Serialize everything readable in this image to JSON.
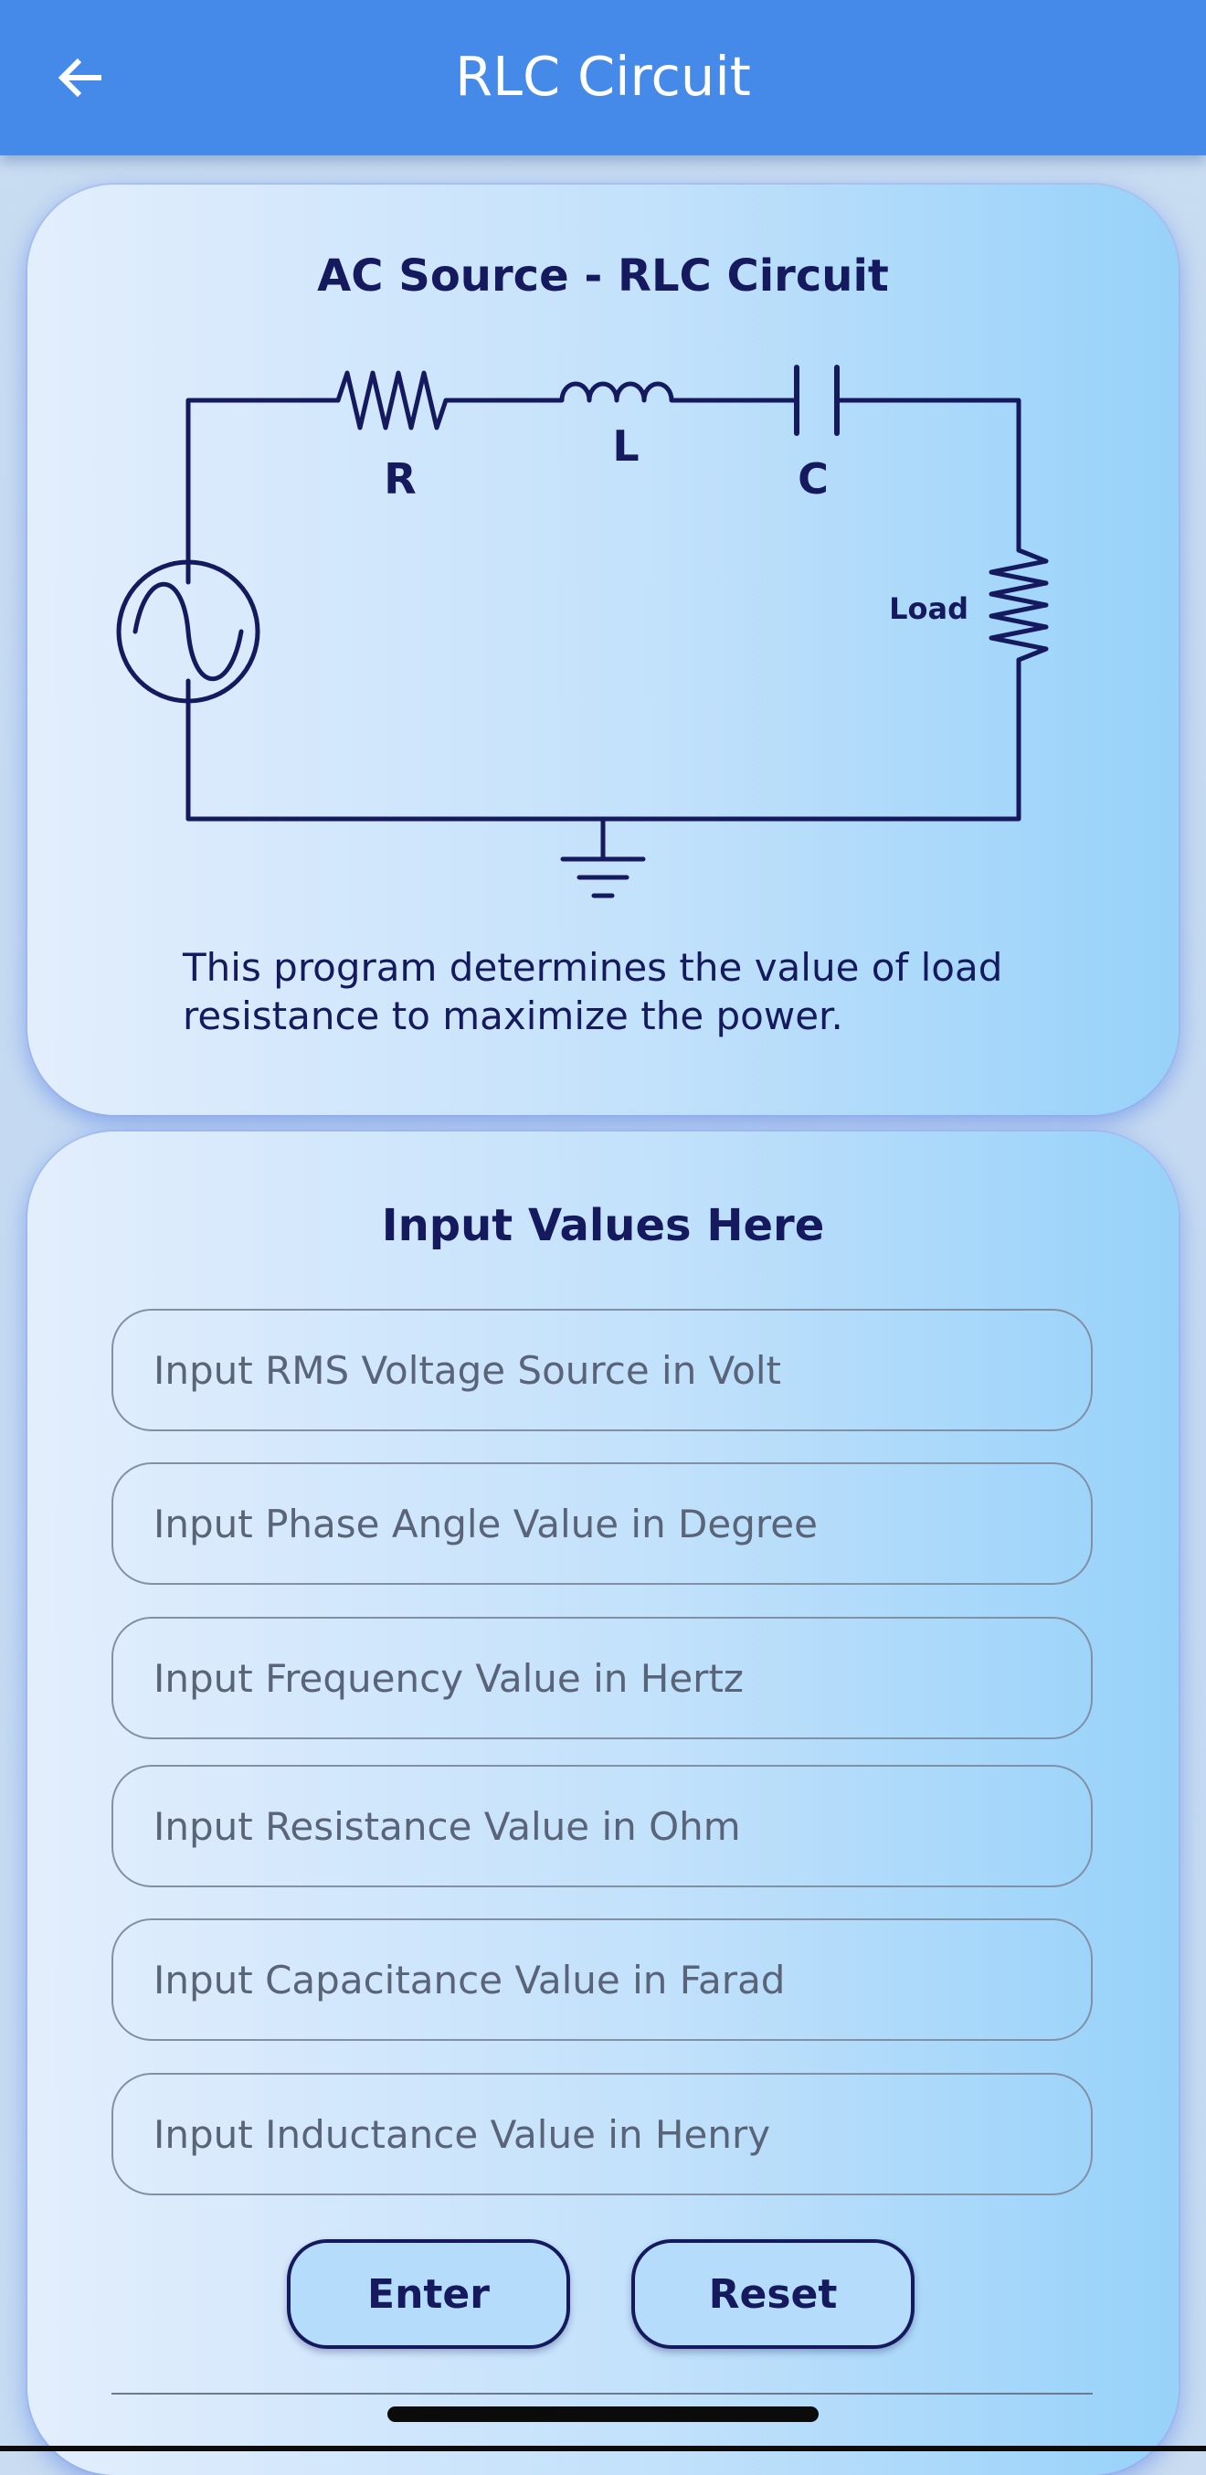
{
  "app_bar": {
    "title": "RLC Circuit",
    "back_icon": "arrow-left-icon",
    "color": "#458ae8"
  },
  "circuit_card": {
    "title": "AC Source - RLC Circuit",
    "labels": {
      "resistor": "R",
      "inductor": "L",
      "capacitor": "C",
      "load": "Load"
    },
    "description": "This program determines the value of load resistance to maximize the power."
  },
  "input_card": {
    "title": "Input Values Here",
    "fields": [
      {
        "placeholder": "Input RMS Voltage Source in Volt",
        "value": ""
      },
      {
        "placeholder": "Input Phase Angle Value in Degree",
        "value": ""
      },
      {
        "placeholder": "Input Frequency Value in Hertz",
        "value": ""
      },
      {
        "placeholder": "Input Resistance Value in Ohm",
        "value": ""
      },
      {
        "placeholder": "Input Capacitance Value in Farad",
        "value": ""
      },
      {
        "placeholder": "Input Inductance Value in Henry",
        "value": ""
      }
    ],
    "enter_label": "Enter",
    "reset_label": "Reset"
  },
  "colors": {
    "ink": "#15195e",
    "accent": "#458ae8"
  }
}
